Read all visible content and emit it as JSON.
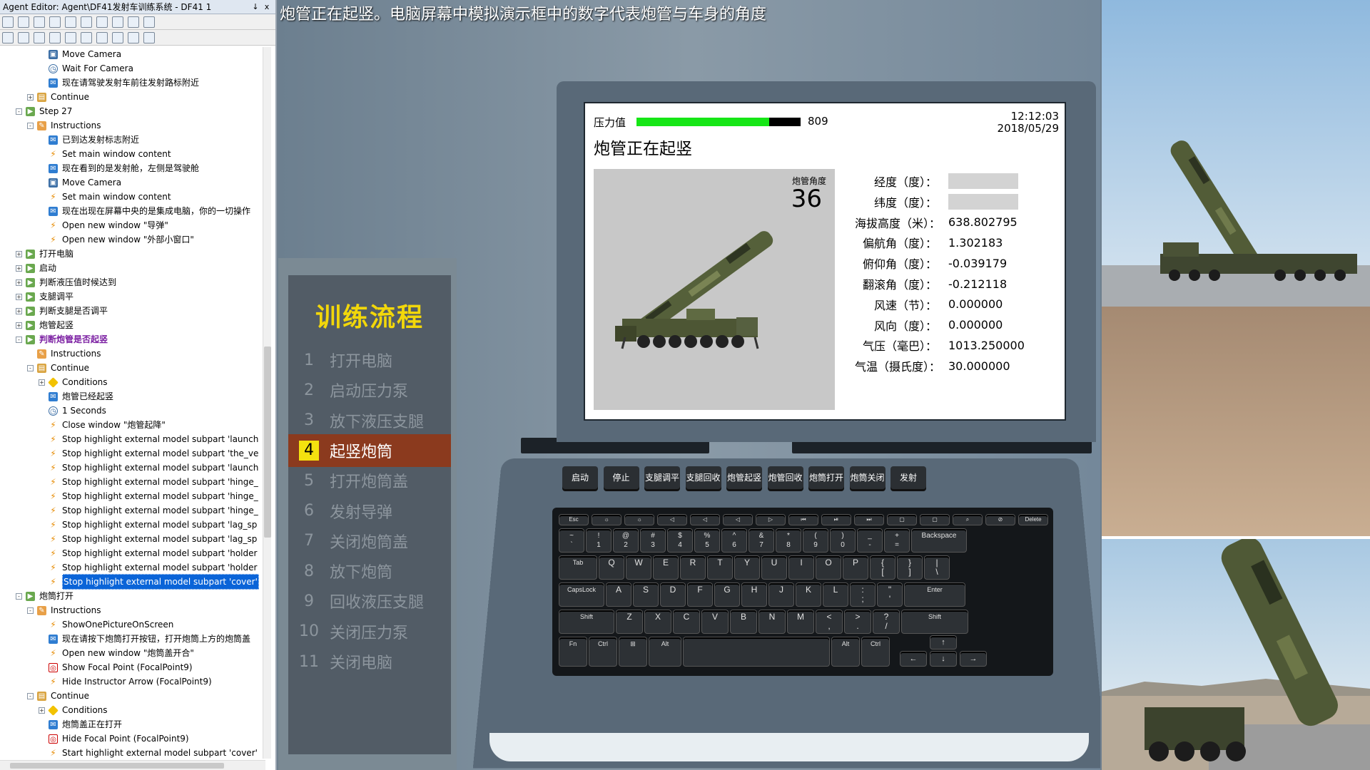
{
  "editor": {
    "title": "Agent Editor: Agent\\DF41发射车训练系统 - DF41 1",
    "title_pin": "↓",
    "title_close": "x",
    "tree_rows": [
      {
        "indent": 3,
        "icon": "cam",
        "label": "Move Camera"
      },
      {
        "indent": 3,
        "icon": "wait",
        "label": "Wait For Camera"
      },
      {
        "indent": 3,
        "icon": "msg",
        "label": "现在请驾驶发射车前往发射路标附近"
      },
      {
        "indent": 2,
        "icon": "cont",
        "exp": "+",
        "label": "Continue"
      },
      {
        "indent": 1,
        "icon": "step",
        "exp": "-",
        "label": "Step 27"
      },
      {
        "indent": 2,
        "icon": "instr",
        "exp": "-",
        "label": "Instructions"
      },
      {
        "indent": 3,
        "icon": "msg",
        "label": "已到达发射标志附近"
      },
      {
        "indent": 3,
        "icon": "bolt",
        "label": "Set main window content"
      },
      {
        "indent": 3,
        "icon": "msg",
        "label": "现在看到的是发射舱，左侧是驾驶舱"
      },
      {
        "indent": 3,
        "icon": "cam",
        "label": "Move Camera"
      },
      {
        "indent": 3,
        "icon": "bolt",
        "label": "Set main window content"
      },
      {
        "indent": 3,
        "icon": "msg",
        "label": "现在出现在屏幕中央的是集成电脑，你的一切操作"
      },
      {
        "indent": 3,
        "icon": "bolt",
        "label": "Open new window \"导弹\""
      },
      {
        "indent": 3,
        "icon": "bolt",
        "label": "Open new window \"外部小窗口\""
      },
      {
        "indent": 1,
        "icon": "step",
        "exp": "+",
        "label": "打开电脑"
      },
      {
        "indent": 1,
        "icon": "step",
        "exp": "+",
        "label": "启动"
      },
      {
        "indent": 1,
        "icon": "step",
        "exp": "+",
        "label": "判断液压值时候达到"
      },
      {
        "indent": 1,
        "icon": "step",
        "exp": "+",
        "label": "支腿调平"
      },
      {
        "indent": 1,
        "icon": "step",
        "exp": "+",
        "label": "判断支腿是否调平"
      },
      {
        "indent": 1,
        "icon": "step",
        "exp": "+",
        "label": "炮管起竖"
      },
      {
        "indent": 1,
        "icon": "step",
        "exp": "-",
        "label": "判断炮管是否起竖",
        "purple": true
      },
      {
        "indent": 2,
        "icon": "instr",
        "label": "Instructions"
      },
      {
        "indent": 2,
        "icon": "cont",
        "exp": "-",
        "label": "Continue"
      },
      {
        "indent": 3,
        "icon": "cond",
        "exp": "+",
        "label": "Conditions"
      },
      {
        "indent": 3,
        "icon": "msg",
        "label": "炮管已经起竖"
      },
      {
        "indent": 3,
        "icon": "wait",
        "label": "1 Seconds"
      },
      {
        "indent": 3,
        "icon": "bolt",
        "label": "Close window \"炮管起降\""
      },
      {
        "indent": 3,
        "icon": "bolt",
        "label": "Stop highlight external model subpart 'launch"
      },
      {
        "indent": 3,
        "icon": "bolt",
        "label": "Stop highlight external model subpart 'the_ve"
      },
      {
        "indent": 3,
        "icon": "bolt",
        "label": "Stop highlight external model subpart 'launch"
      },
      {
        "indent": 3,
        "icon": "bolt",
        "label": "Stop highlight external model subpart 'hinge_"
      },
      {
        "indent": 3,
        "icon": "bolt",
        "label": "Stop highlight external model subpart 'hinge_"
      },
      {
        "indent": 3,
        "icon": "bolt",
        "label": "Stop highlight external model subpart 'hinge_"
      },
      {
        "indent": 3,
        "icon": "bolt",
        "label": "Stop highlight external model subpart 'lag_sp"
      },
      {
        "indent": 3,
        "icon": "bolt",
        "label": "Stop highlight external model subpart 'lag_sp"
      },
      {
        "indent": 3,
        "icon": "bolt",
        "label": "Stop highlight external model subpart 'holder"
      },
      {
        "indent": 3,
        "icon": "bolt",
        "label": "Stop highlight external model subpart 'holder"
      },
      {
        "indent": 3,
        "icon": "bolt",
        "label": "Stop highlight external model subpart 'cover'",
        "selected": true
      },
      {
        "indent": 1,
        "icon": "step",
        "exp": "-",
        "label": "炮筒打开"
      },
      {
        "indent": 2,
        "icon": "instr",
        "exp": "-",
        "label": "Instructions"
      },
      {
        "indent": 3,
        "icon": "bolt",
        "label": "ShowOnePictureOnScreen"
      },
      {
        "indent": 3,
        "icon": "msg",
        "label": "现在请按下炮筒打开按钮，打开炮筒上方的炮筒盖"
      },
      {
        "indent": 3,
        "icon": "bolt",
        "label": "Open new window \"炮筒盖开合\""
      },
      {
        "indent": 3,
        "icon": "focal",
        "label": "Show Focal Point (FocalPoint9)"
      },
      {
        "indent": 3,
        "icon": "bolt",
        "label": "Hide Instructor Arrow (FocalPoint9)"
      },
      {
        "indent": 2,
        "icon": "cont",
        "exp": "-",
        "label": "Continue"
      },
      {
        "indent": 3,
        "icon": "cond",
        "exp": "+",
        "label": "Conditions"
      },
      {
        "indent": 3,
        "icon": "msg",
        "label": "炮筒盖正在打开"
      },
      {
        "indent": 3,
        "icon": "focal",
        "label": "Hide Focal Point (FocalPoint9)"
      },
      {
        "indent": 3,
        "icon": "bolt",
        "label": "Start highlight external model subpart 'cover'"
      }
    ]
  },
  "scene": {
    "caption": "炮管正在起竖。电脑屏幕中模拟演示框中的数字代表炮管与车身的角度"
  },
  "training_flow": {
    "title": "训练流程",
    "active_index": 3,
    "steps": [
      {
        "num": "1",
        "label": "打开电脑"
      },
      {
        "num": "2",
        "label": "启动压力泵"
      },
      {
        "num": "3",
        "label": "放下液压支腿"
      },
      {
        "num": "4",
        "label": "起竖炮筒"
      },
      {
        "num": "5",
        "label": "打开炮筒盖"
      },
      {
        "num": "6",
        "label": "发射导弹"
      },
      {
        "num": "7",
        "label": "关闭炮筒盖"
      },
      {
        "num": "8",
        "label": "放下炮筒"
      },
      {
        "num": "9",
        "label": "回收液压支腿"
      },
      {
        "num": "10",
        "label": "关闭压力泵"
      },
      {
        "num": "11",
        "label": "关闭电脑"
      }
    ]
  },
  "screen": {
    "pressure_label": "压力值",
    "pressure_value": "809",
    "pressure_fraction": 0.81,
    "time": "12:12:03",
    "date": "2018/05/29",
    "title": "炮管正在起竖",
    "angle_label": "炮管角度",
    "angle_value": "36",
    "info": [
      {
        "key": "经度（度）：",
        "value": ""
      },
      {
        "key": "纬度（度）：",
        "value": ""
      },
      {
        "key": "海拔高度（米）：",
        "value": "638.802795"
      },
      {
        "key": "偏航角（度）：",
        "value": "1.302183"
      },
      {
        "key": "俯仰角（度）：",
        "value": "-0.039179"
      },
      {
        "key": "翻滚角（度）：",
        "value": "-0.212118"
      },
      {
        "key": "风速（节）：",
        "value": "0.000000"
      },
      {
        "key": "风向（度）：",
        "value": "0.000000"
      },
      {
        "key": "气压（毫巴）：",
        "value": "1013.250000"
      },
      {
        "key": "气温（摄氏度）：",
        "value": "30.000000"
      }
    ]
  },
  "function_buttons": [
    "启动",
    "停止",
    "支腿调平",
    "支腿回收",
    "炮管起竖",
    "炮管回收",
    "炮筒打开",
    "炮筒关闭",
    "发射"
  ],
  "keyboard": {
    "row1": [
      "Esc",
      "☼",
      "☼",
      "◁",
      "◁",
      "◁",
      "▷",
      "⏮",
      "⏯",
      "⏭",
      "▢",
      "▢",
      "⌕",
      "⊘",
      "Delete"
    ],
    "row2": [
      "~\n`",
      "!\n1",
      "@\n2",
      "#\n3",
      "$\n4",
      "%\n5",
      "^\n6",
      "&\n7",
      "*\n8",
      "(\n9",
      ")\n0",
      "_\n-",
      "+\n=",
      "Backspace"
    ],
    "row3": [
      "Tab",
      "Q",
      "W",
      "E",
      "R",
      "T",
      "Y",
      "U",
      "I",
      "O",
      "P",
      "{\n[",
      "}\n]",
      "|\n\\"
    ],
    "row4": [
      "CapsLock",
      "A",
      "S",
      "D",
      "F",
      "G",
      "H",
      "J",
      "K",
      "L",
      ":\n;",
      "\"\n'",
      "Enter"
    ],
    "row5": [
      "Shift",
      "Z",
      "X",
      "C",
      "V",
      "B",
      "N",
      "M",
      "<\n,",
      ">\n.",
      "?\n/",
      "Shift"
    ],
    "row6": [
      "Fn",
      "Ctrl",
      "⊞",
      "Alt",
      "",
      "Alt",
      "Ctrl"
    ],
    "arrows": [
      "↑",
      "←",
      "↓",
      "→"
    ]
  },
  "colors": {
    "flow_title": "#f2d70a",
    "flow_active_bg": "#8b3a1e",
    "pressure_fill": "#16e616",
    "selection": "#0a64d8"
  }
}
